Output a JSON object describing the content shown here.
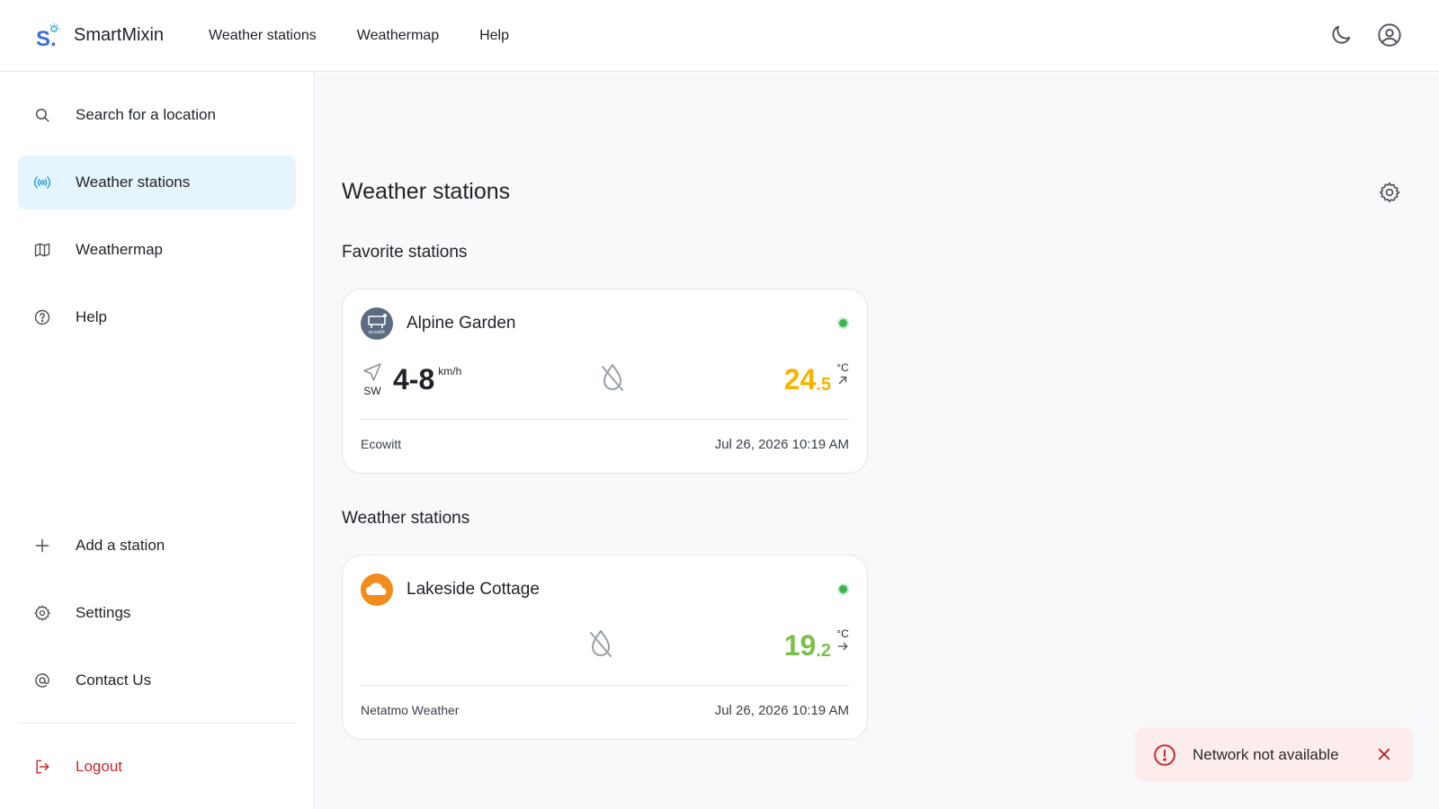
{
  "app": {
    "brand_name": "SmartMixin",
    "brand_logo_letter": "S."
  },
  "topnav": {
    "items": [
      {
        "label": "Weather stations"
      },
      {
        "label": "Weathermap"
      },
      {
        "label": "Help"
      }
    ]
  },
  "sidebar": {
    "items": [
      {
        "label": "Search for a location",
        "icon": "search-icon"
      },
      {
        "label": "Weather stations",
        "icon": "broadcast-icon",
        "active": true
      },
      {
        "label": "Weathermap",
        "icon": "map-icon"
      },
      {
        "label": "Help",
        "icon": "help-circle-icon"
      }
    ],
    "bottom_items": [
      {
        "label": "Add a station",
        "icon": "plus-icon"
      },
      {
        "label": "Settings",
        "icon": "gear-icon"
      },
      {
        "label": "Contact Us",
        "icon": "at-icon"
      }
    ],
    "logout_label": "Logout"
  },
  "main": {
    "title": "Weather stations",
    "favorites_title": "Favorite stations",
    "stations_title": "Weather stations",
    "favorite_station": {
      "name": "Alpine Garden",
      "avatar_text": "ecowitt",
      "wind_dir": "SW",
      "wind_value": "4-8",
      "wind_unit": "km/h",
      "temp_int": "24",
      "temp_dec": ".5",
      "temp_unit": "°C",
      "temp_color": "#f5b400",
      "provider": "Ecowitt",
      "timestamp": "Jul 26, 2026 10:19 AM",
      "status_color": "#3fb34f"
    },
    "station": {
      "name": "Lakeside Cottage",
      "temp_int": "19",
      "temp_dec": ".2",
      "temp_unit": "°C",
      "temp_color": "#7cc04b",
      "provider": "Netatmo Weather",
      "timestamp": "Jul 26, 2026 10:19 AM",
      "status_color": "#3fb34f"
    }
  },
  "toast": {
    "message": "Network not available"
  },
  "colors": {
    "accent": "#29a8e0",
    "active_bg": "#e6f4fb",
    "logout": "#c62828",
    "toast_bg": "#fdecec",
    "toast_icon": "#c62828"
  }
}
